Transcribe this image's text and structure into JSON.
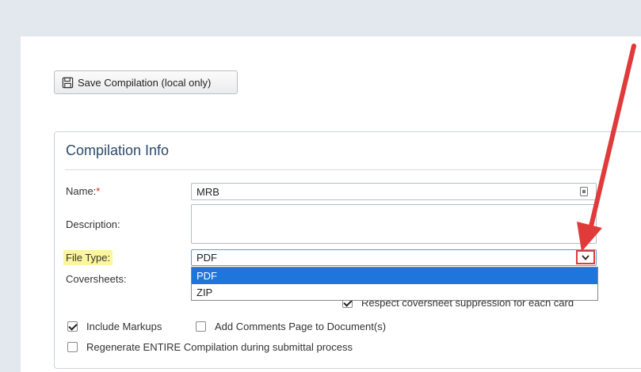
{
  "toolbar": {
    "save_label": "Save Compilation (local only)"
  },
  "panel": {
    "title": "Compilation Info"
  },
  "form": {
    "name_label": "Name:",
    "required_marker": "*",
    "name_value": "MRB",
    "description_label": "Description:",
    "description_value": "",
    "file_type_label": "File Type:",
    "file_type_value": "PDF",
    "file_type_options": [
      "PDF",
      "ZIP"
    ],
    "file_type_highlighted_option": "PDF",
    "coversheets_label": "Coversheets:",
    "respect_coversheet_label": "Respect coversheet suppression for each card",
    "respect_coversheet_checked": true,
    "include_markups_label": "Include Markups",
    "include_markups_checked": true,
    "add_comments_label": "Add Comments Page to Document(s)",
    "add_comments_checked": false,
    "regenerate_label": "Regenerate ENTIRE Compilation during submittal process",
    "regenerate_checked": false
  },
  "colors": {
    "highlight": "#fbf59b",
    "annotation_red": "#e03a3a",
    "selected_option_bg": "#1e75dc",
    "title_color": "#2c4a6b"
  },
  "icons": {
    "save": "floppy-disk-icon",
    "dropdown": "chevron-down-icon",
    "lock": "lock-icon"
  }
}
